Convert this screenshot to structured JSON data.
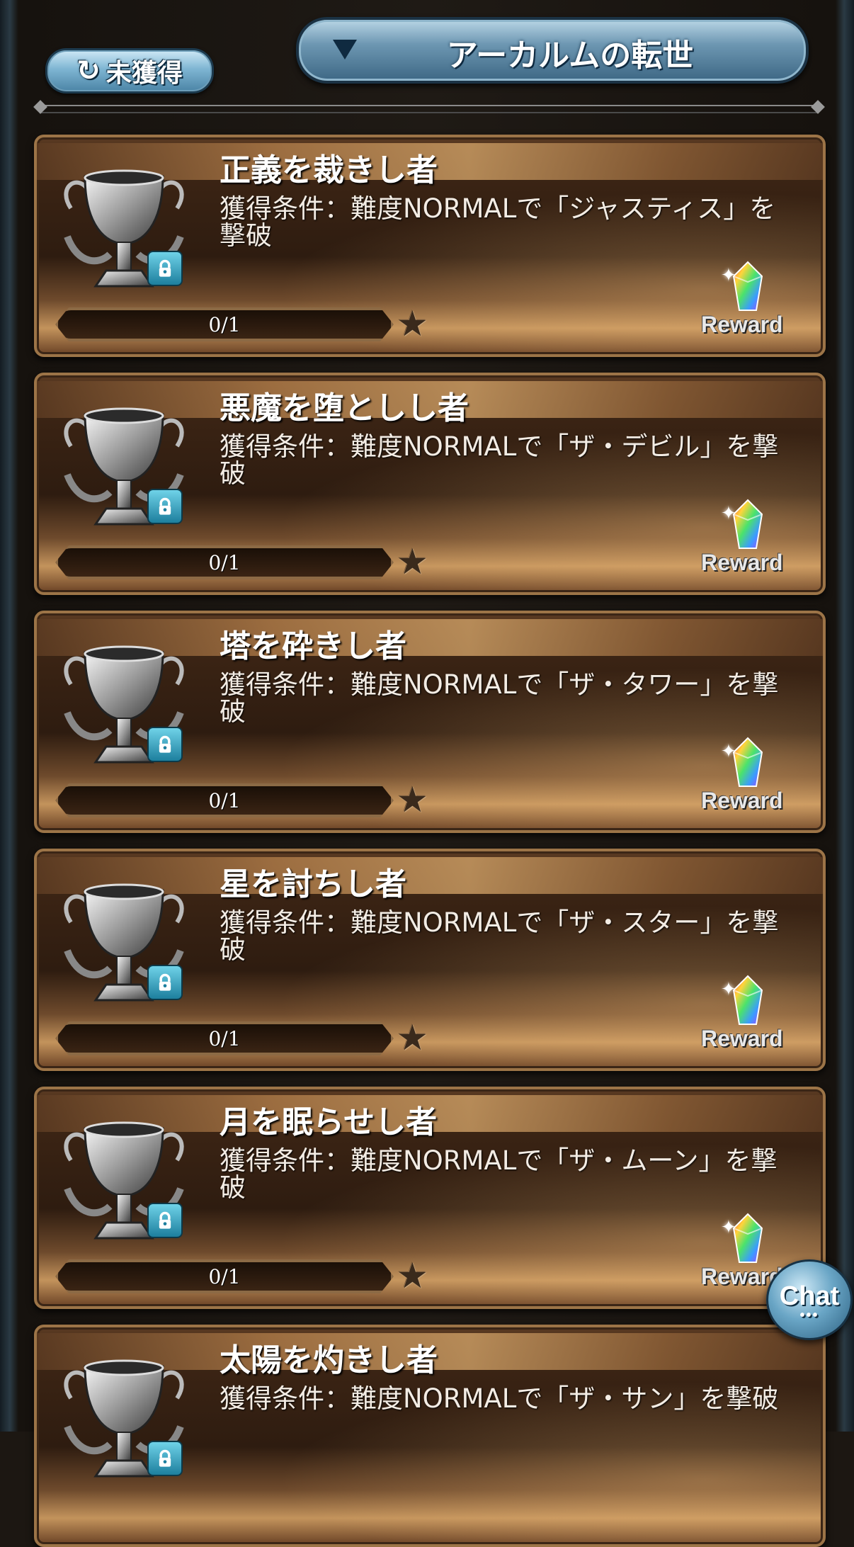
{
  "header": {
    "filter_label": "未獲得",
    "category_selected": "アーカルムの転世"
  },
  "achievements": [
    {
      "title": "正義を裁きし者",
      "condition": "獲得条件：難度NORMALで「ジャスティス」を撃破",
      "progress_text": "0/1",
      "reward_label": "Reward"
    },
    {
      "title": "悪魔を堕としし者",
      "condition": "獲得条件：難度NORMALで「ザ・デビル」を撃破",
      "progress_text": "0/1",
      "reward_label": "Reward"
    },
    {
      "title": "塔を砕きし者",
      "condition": "獲得条件：難度NORMALで「ザ・タワー」を撃破",
      "progress_text": "0/1",
      "reward_label": "Reward"
    },
    {
      "title": "星を討ちし者",
      "condition": "獲得条件：難度NORMALで「ザ・スター」を撃破",
      "progress_text": "0/1",
      "reward_label": "Reward"
    },
    {
      "title": "月を眠らせし者",
      "condition": "獲得条件：難度NORMALで「ザ・ムーン」を撃破",
      "progress_text": "0/1",
      "reward_label": "Reward"
    },
    {
      "title": "太陽を灼きし者",
      "condition": "獲得条件：難度NORMALで「ザ・サン」を撃破",
      "progress_text": "",
      "reward_label": ""
    }
  ],
  "chat": {
    "label": "Chat",
    "dots": "•••"
  },
  "icons": {
    "filter": "refresh-icon",
    "dropdown": "chevron-down-icon",
    "trophy": "trophy-icon",
    "lock": "lock-icon",
    "star": "star-icon",
    "reward": "rainbow-crystal-icon"
  }
}
